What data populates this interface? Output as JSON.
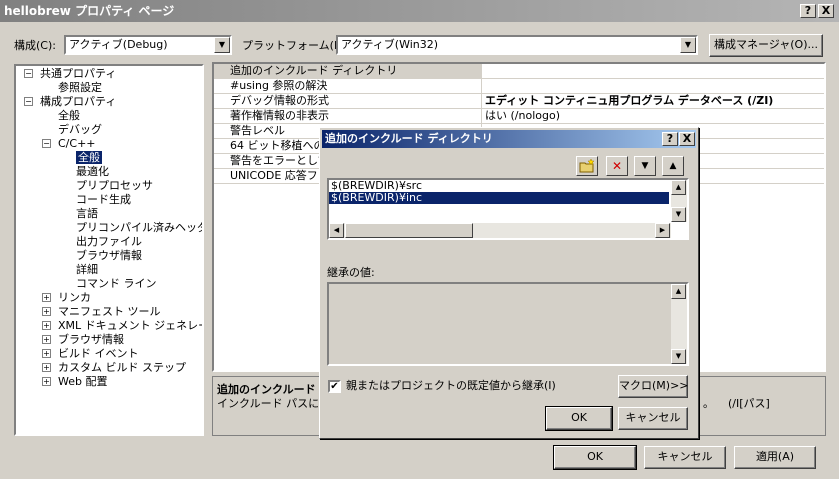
{
  "window": {
    "title": "hellobrew プロパティ ページ",
    "help_btn": "?",
    "close_btn": "X"
  },
  "toolbar": {
    "config_label": "構成(C):",
    "config_value": "アクティブ(Debug)",
    "platform_label": "プラットフォーム(P):",
    "platform_value": "アクティブ(Win32)",
    "config_manager": "構成マネージャ(O)..."
  },
  "tree": {
    "items": [
      {
        "label": "共通プロパティ",
        "pm": "−"
      },
      {
        "label": "参照設定"
      },
      {
        "label": "構成プロパティ",
        "pm": "−"
      },
      {
        "label": "全般"
      },
      {
        "label": "デバッグ"
      },
      {
        "label": "C/C++",
        "pm": "−"
      },
      {
        "label": "全般"
      },
      {
        "label": "最適化"
      },
      {
        "label": "プリプロセッサ"
      },
      {
        "label": "コード生成"
      },
      {
        "label": "言語"
      },
      {
        "label": "プリコンパイル済みヘッダー"
      },
      {
        "label": "出力ファイル"
      },
      {
        "label": "ブラウザ情報"
      },
      {
        "label": "詳細"
      },
      {
        "label": "コマンド ライン"
      },
      {
        "label": "リンカ",
        "pm": "+"
      },
      {
        "label": "マニフェスト ツール",
        "pm": "+"
      },
      {
        "label": "XML ドキュメント ジェネレータ",
        "pm": "+"
      },
      {
        "label": "ブラウザ情報",
        "pm": "+"
      },
      {
        "label": "ビルド イベント",
        "pm": "+"
      },
      {
        "label": "カスタム ビルド ステップ",
        "pm": "+"
      },
      {
        "label": "Web 配置",
        "pm": "+"
      }
    ]
  },
  "grid": {
    "rows": [
      {
        "key": "追加のインクルード ディレクトリ",
        "value": ""
      },
      {
        "key": "#using 参照の解決",
        "value": ""
      },
      {
        "key": "デバッグ情報の形式",
        "value": "エディット コンティニュ用プログラム データベース (/ZI)"
      },
      {
        "key": "著作権情報の非表示",
        "value": "はい (/nologo)"
      },
      {
        "key": "警告レベル",
        "value": ""
      },
      {
        "key": "64 ビット移植への対",
        "value": ""
      },
      {
        "key": "警告をエラーとして",
        "value": ""
      },
      {
        "key": "UNICODE 応答フ",
        "value": ""
      }
    ]
  },
  "description": {
    "title": "追加のインクルード",
    "text": "インクルード パスに追",
    "right_text": "。    (/I[パス]"
  },
  "main_buttons": {
    "ok": "OK",
    "cancel": "キャンセル",
    "apply": "適用(A)"
  },
  "dialog": {
    "title": "追加のインクルード ディレクトリ",
    "help_btn": "?",
    "close_btn": "X",
    "list": [
      "$(BREWDIR)¥src",
      "$(BREWDIR)¥inc"
    ],
    "inherited_label": "継承の値:",
    "inherit_checkbox": "親またはプロジェクトの既定値から継承(I)",
    "macro_btn": "マクロ(M)>>",
    "ok": "OK",
    "cancel": "キャンセル"
  }
}
